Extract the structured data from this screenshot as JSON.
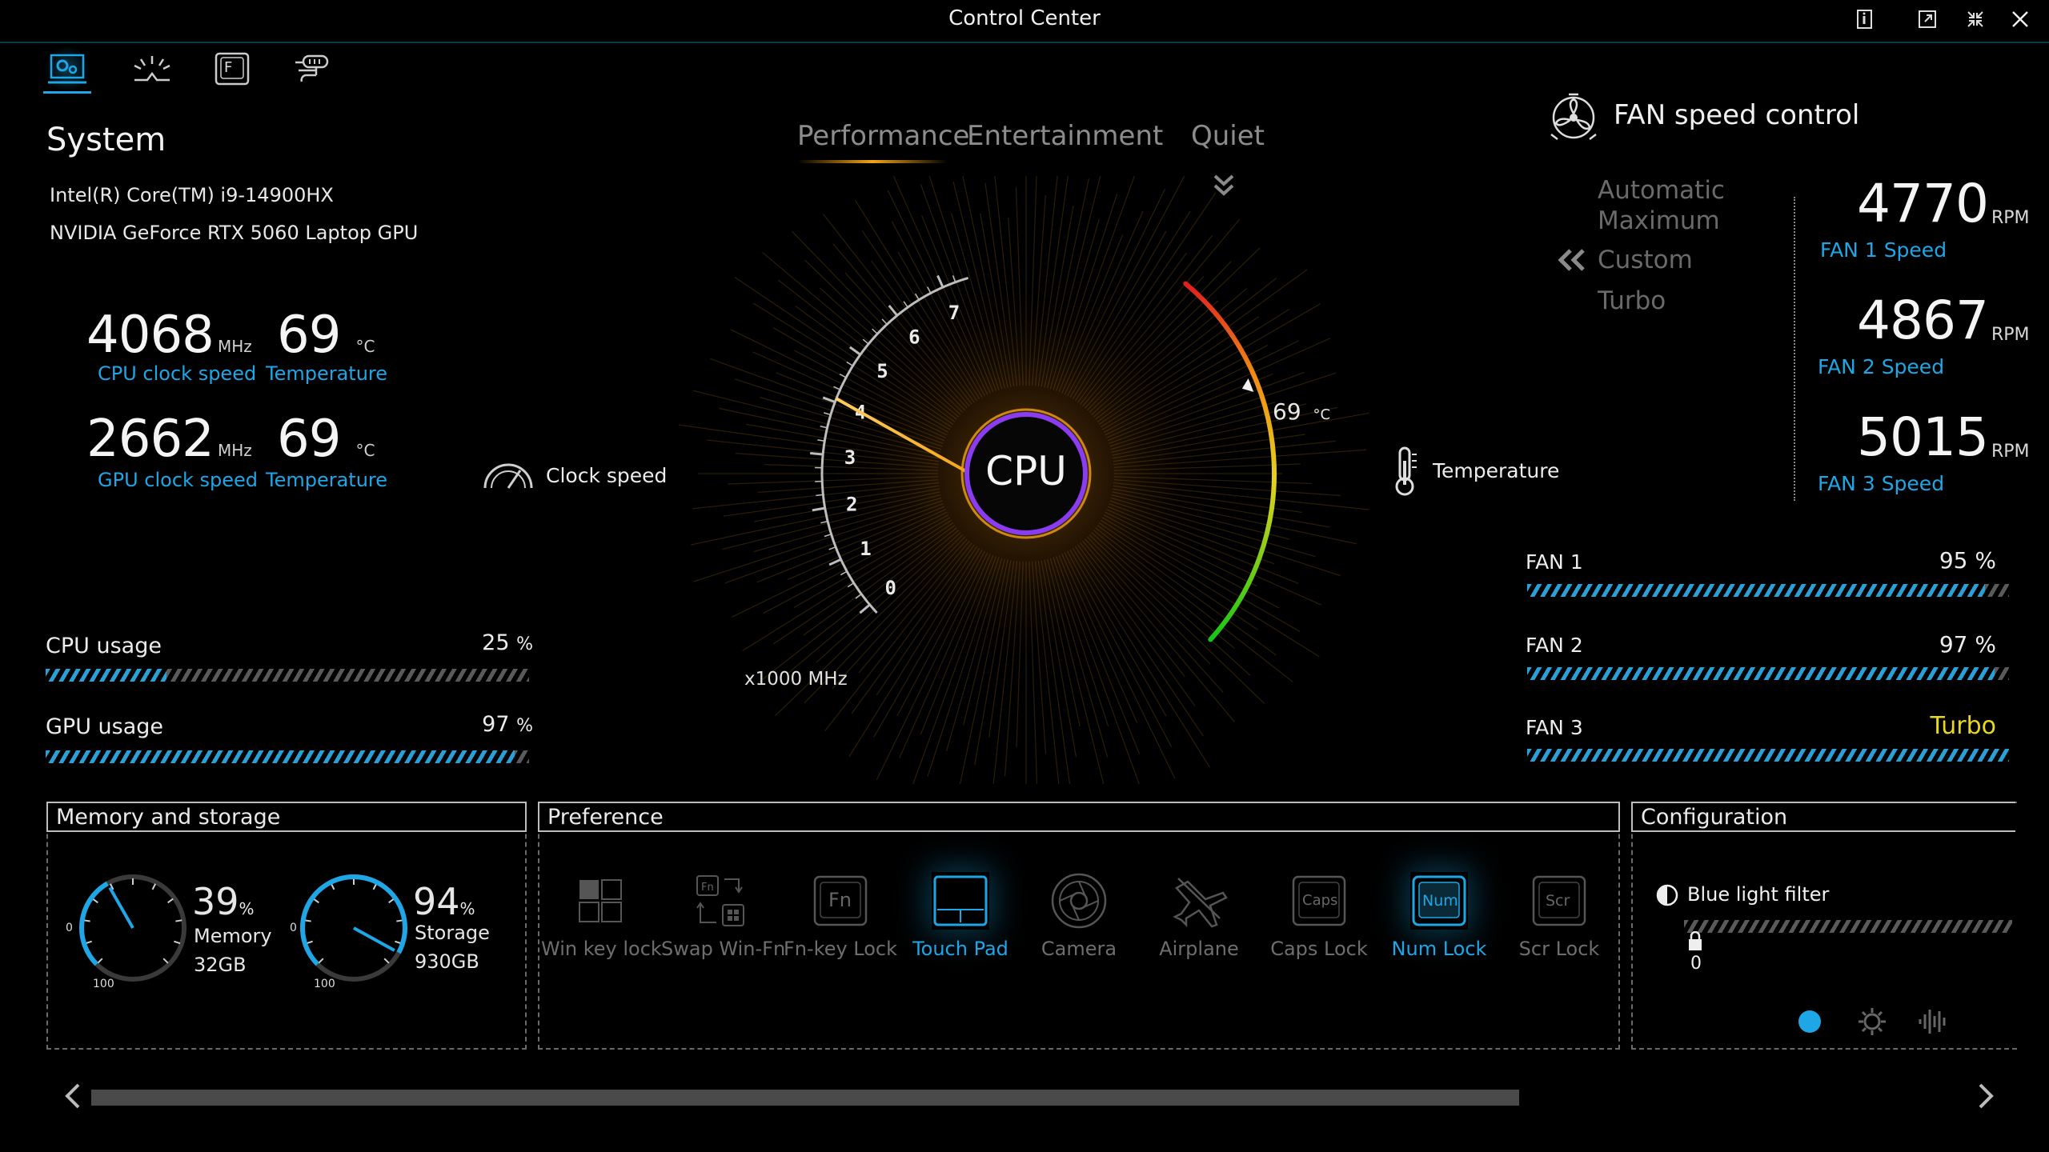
{
  "window": {
    "title": "Control Center"
  },
  "system": {
    "heading": "System",
    "cpu_name": "Intel(R) Core(TM) i9-14900HX",
    "gpu_name": "NVIDIA GeForce RTX 5060 Laptop GPU",
    "cpu_clock": {
      "value": "4068",
      "unit": "MHz",
      "label": "CPU clock speed"
    },
    "cpu_temp": {
      "value": "69",
      "unit": "°C",
      "label": "Temperature"
    },
    "gpu_clock": {
      "value": "2662",
      "unit": "MHz",
      "label": "GPU clock speed"
    },
    "gpu_temp": {
      "value": "69",
      "unit": "°C",
      "label": "Temperature"
    },
    "cpu_usage": {
      "label": "CPU usage",
      "value": "25",
      "unit": "%",
      "fraction": 0.25
    },
    "gpu_usage": {
      "label": "GPU usage",
      "value": "97",
      "unit": "%",
      "fraction": 0.97
    }
  },
  "modes": {
    "performance": "Performance",
    "entertainment": "Entertainment",
    "quiet": "Quiet",
    "active": "Performance"
  },
  "gauge": {
    "center_label": "CPU",
    "clock_label": "Clock speed",
    "temp_label": "Temperature",
    "unit_label": "x1000 MHz",
    "ticks": [
      "0",
      "1",
      "2",
      "3",
      "4",
      "5",
      "6",
      "7"
    ],
    "clock_value_ghz": 4.068,
    "temp_value": "69",
    "temp_unit": "°C"
  },
  "fan": {
    "heading": "FAN speed control",
    "options": {
      "automatic": "Automatic",
      "maximum": "Maximum",
      "custom": "Custom",
      "turbo": "Turbo",
      "selected": "Turbo"
    },
    "fan1": {
      "rpm": "4770",
      "unit": "RPM",
      "label": "FAN 1 Speed",
      "bar_label": "FAN 1",
      "percent": "95 %",
      "fraction": 0.95
    },
    "fan2": {
      "rpm": "4867",
      "unit": "RPM",
      "label": "FAN 2 Speed",
      "bar_label": "FAN 2",
      "percent": "97 %",
      "fraction": 0.97
    },
    "fan3": {
      "rpm": "5015",
      "unit": "RPM",
      "label": "FAN 3 Speed",
      "bar_label": "FAN 3",
      "percent": "Turbo",
      "fraction": 1.0
    }
  },
  "memory_storage": {
    "title": "Memory and storage",
    "memory": {
      "percent": "39",
      "unit": "%",
      "label": "Memory",
      "size": "32GB",
      "fraction": 0.39,
      "min": "0",
      "max": "100"
    },
    "storage": {
      "percent": "94",
      "unit": "%",
      "label": "Storage",
      "size": "930GB",
      "fraction": 0.94,
      "min": "0",
      "max": "100"
    }
  },
  "preference": {
    "title": "Preference",
    "items": [
      {
        "label": "Win key lock",
        "active": false
      },
      {
        "label": "Swap Win-Fn",
        "active": false
      },
      {
        "label": "Fn-key Lock",
        "active": false
      },
      {
        "label": "Touch Pad",
        "active": true
      },
      {
        "label": "Camera",
        "active": false
      },
      {
        "label": "Airplane",
        "active": false
      },
      {
        "label": "Caps Lock",
        "active": false
      },
      {
        "label": "Num Lock",
        "active": true
      },
      {
        "label": "Scr Lock",
        "active": false
      }
    ],
    "key_icons": {
      "fn": "Fn",
      "caps": "Caps",
      "num": "Num",
      "scr": "Scr"
    }
  },
  "configuration": {
    "title": "Configuration",
    "blue_light_label": "Blue light filter",
    "blue_light_value": "0"
  },
  "colors": {
    "accent_blue": "#1ea6e6",
    "accent_orange": "#f2a416",
    "background": "#000000"
  }
}
